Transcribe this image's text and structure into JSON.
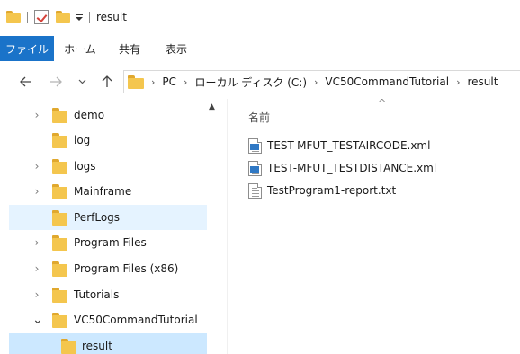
{
  "window": {
    "title": "result"
  },
  "ribbon": {
    "tabs": [
      "ファイル",
      "ホーム",
      "共有",
      "表示"
    ]
  },
  "address": {
    "crumbs": [
      "PC",
      "ローカル ディスク (C:)",
      "VC50CommandTutorial",
      "result"
    ]
  },
  "nav": {
    "items": [
      {
        "label": "demo",
        "expander": "›"
      },
      {
        "label": "log",
        "expander": ""
      },
      {
        "label": "logs",
        "expander": "›"
      },
      {
        "label": "Mainframe",
        "expander": "›"
      },
      {
        "label": "PerfLogs",
        "expander": ""
      },
      {
        "label": "Program Files",
        "expander": "›"
      },
      {
        "label": "Program Files (x86)",
        "expander": "›"
      },
      {
        "label": "Tutorials",
        "expander": "›"
      },
      {
        "label": "VC50CommandTutorial",
        "expander": "⌄"
      },
      {
        "label": "result",
        "expander": ""
      }
    ],
    "scroll_up": "▲"
  },
  "content": {
    "column_name": "名前",
    "sort_caret": "^",
    "files": [
      {
        "name": "TEST-MFUT_TESTAIRCODE.xml",
        "type": "xml"
      },
      {
        "name": "TEST-MFUT_TESTDISTANCE.xml",
        "type": "xml"
      },
      {
        "name": "TestProgram1-report.txt",
        "type": "txt"
      }
    ]
  },
  "icons": {
    "back": "back-arrow-icon",
    "forward": "forward-arrow-icon",
    "recent": "chevron-down-icon",
    "up": "up-arrow-icon"
  },
  "colors": {
    "file_tab": "#1a73c9",
    "folder_yellow": "#f4c64e",
    "folder_tab": "#e0a82e",
    "selected_row": "#cce8ff",
    "hover_row": "#e5f3ff"
  }
}
